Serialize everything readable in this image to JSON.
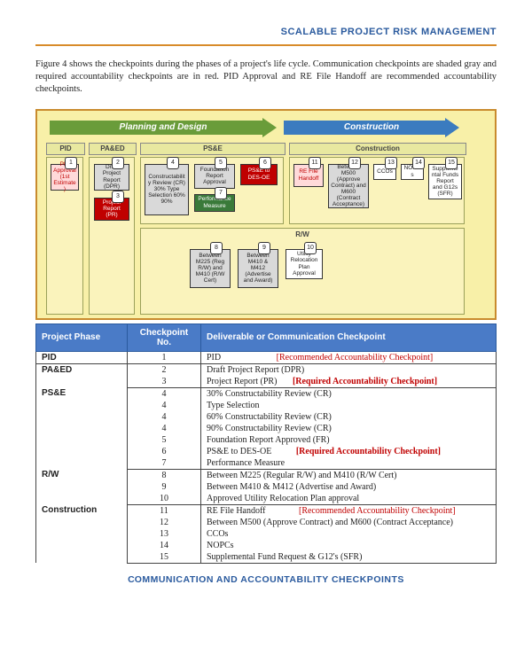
{
  "header": "SCALABLE PROJECT RISK MANAGEMENT",
  "intro": "Figure 4 shows the checkpoints during the phases of a project's life cycle.  Communication checkpoints are shaded gray and required accountability checkpoints are in red.  PID Approval and RE File Handoff are recommended accountability checkpoints.",
  "diagram": {
    "arrows": {
      "a1": "Planning and Design",
      "a2": "Construction"
    },
    "phases": {
      "pid": "PID",
      "paed": "PA&ED",
      "pse": "PS&E",
      "con": "Construction",
      "rw": "R/W"
    },
    "boxes": {
      "b1": "PID Approval (1st Estimate)",
      "b2": "Draft Project Report (DPR)",
      "b3": "Project Report (PR)",
      "b4": "Constructability Review (CR) 30% Type Selection 60% 90%",
      "b5": "Foundation Report Approval",
      "b6": "PS&E to DES-OE",
      "b7": "Performance Measure",
      "b8": "Between M225 (Reg R/W) and M410 (R/W Cert)",
      "b9": "Between M410 & M412 (Advertise and Award)",
      "b10": "Utility Relocation Plan Approval",
      "b11": "RE File Handoff",
      "b12": "Between M500 (Approve Contract) and M600 (Contract Acceptance)",
      "b13": "CCOs",
      "b14": "NOPCs",
      "b15": "Supplemental Funds Report and G12s (SFR)"
    },
    "nums": {
      "n1": "1",
      "n2": "2",
      "n3": "3",
      "n4": "4",
      "n5": "5",
      "n6": "6",
      "n7": "7",
      "n8": "8",
      "n9": "9",
      "n10": "10",
      "n11": "11",
      "n12": "12",
      "n13": "13",
      "n14": "14",
      "n15": "15"
    }
  },
  "table": {
    "headers": {
      "h1": "Project Phase",
      "h2": "Checkpoint No.",
      "h3": "Deliverable or Communication Checkpoint"
    },
    "tags": {
      "rec": "[Recommended Accountability Checkpoint]",
      "req": "[Required Accountability Checkpoint]"
    },
    "phases": {
      "p1": "PID",
      "p2": "PA&ED",
      "p3": "PS&E",
      "p4": "R/W",
      "p5": "Construction"
    },
    "rows": {
      "r1": {
        "no": "1",
        "d": "PID"
      },
      "r2": {
        "no": "2",
        "d": "Draft Project Report (DPR)"
      },
      "r3": {
        "no": "3",
        "d": "Project Report (PR)"
      },
      "r4": {
        "no": "4",
        "d": "30% Constructability Review (CR)"
      },
      "r5": {
        "no": "4",
        "d": "Type Selection"
      },
      "r6": {
        "no": "4",
        "d": "60% Constructability Review (CR)"
      },
      "r7": {
        "no": "4",
        "d": "90% Constructability Review (CR)"
      },
      "r8": {
        "no": "5",
        "d": "Foundation Report Approved (FR)"
      },
      "r9": {
        "no": "6",
        "d": "PS&E to DES-OE"
      },
      "r10": {
        "no": "7",
        "d": "Performance Measure"
      },
      "r11": {
        "no": "8",
        "d": "Between M225 (Regular R/W) and M410 (R/W Cert)"
      },
      "r12": {
        "no": "9",
        "d": "Between M410 & M412 (Advertise and Award)"
      },
      "r13": {
        "no": "10",
        "d": "Approved Utility Relocation Plan approval"
      },
      "r14": {
        "no": "11",
        "d": "RE File Handoff"
      },
      "r15": {
        "no": "12",
        "d": "Between M500 (Approve Contract) and M600 (Contract Acceptance)"
      },
      "r16": {
        "no": "13",
        "d": "CCOs"
      },
      "r17": {
        "no": "14",
        "d": "NOPCs"
      },
      "r18": {
        "no": "15",
        "d": "Supplemental Fund Request & G12's (SFR)"
      }
    }
  },
  "caption_prefix": "C",
  "caption_rest": "OMMUNICATION AND ACCOUNTABILITY CHECKPOINTS"
}
